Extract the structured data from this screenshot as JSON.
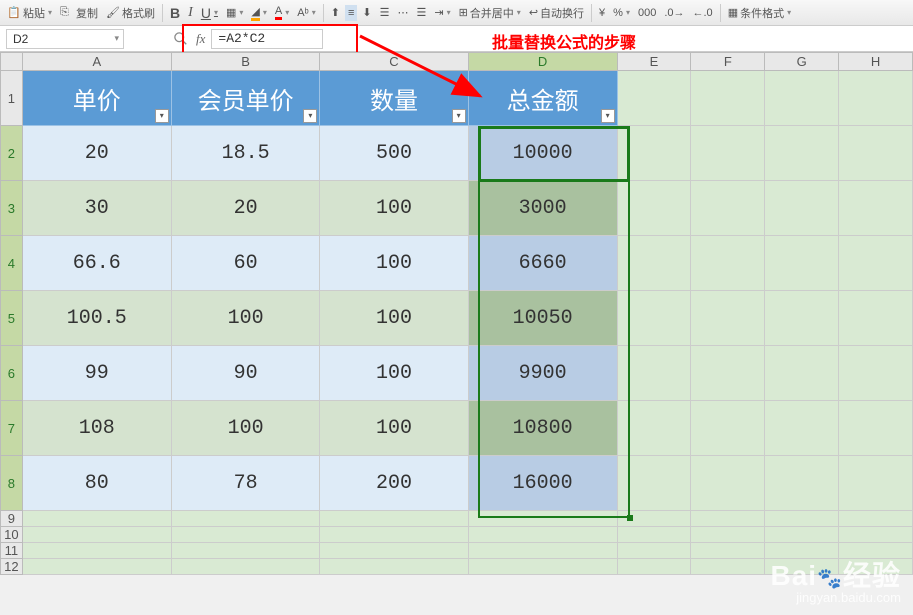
{
  "toolbar": {
    "paste": "粘贴",
    "copy": "复制",
    "format_painter": "格式刷",
    "bold": "B",
    "italic": "I",
    "underline": "U",
    "merge_center": "合并居中",
    "wrap_text": "自动换行",
    "conditional_format": "条件格式"
  },
  "formula_bar": {
    "name_box": "D2",
    "fx": "fx",
    "formula": "=A2*C2"
  },
  "annotation": "批量替换公式的步骤",
  "columns": [
    "A",
    "B",
    "C",
    "D",
    "E",
    "F",
    "G",
    "H"
  ],
  "rows": [
    "1",
    "2",
    "3",
    "4",
    "5",
    "6",
    "7",
    "8",
    "9",
    "10",
    "11",
    "12"
  ],
  "headers": {
    "A": "单价",
    "B": "会员单价",
    "C": "数量",
    "D": "总金额"
  },
  "chart_data": {
    "type": "table",
    "title": "",
    "columns": [
      "单价",
      "会员单价",
      "数量",
      "总金额"
    ],
    "rows": [
      {
        "单价": 20,
        "会员单价": 18.5,
        "数量": 500,
        "总金额": 10000
      },
      {
        "单价": 30,
        "会员单价": 20,
        "数量": 100,
        "总金额": 3000
      },
      {
        "单价": 66.6,
        "会员单价": 60,
        "数量": 100,
        "总金额": 6660
      },
      {
        "单价": 100.5,
        "会员单价": 100,
        "数量": 100,
        "总金额": 10050
      },
      {
        "单价": 99,
        "会员单价": 90,
        "数量": 100,
        "总金额": 9900
      },
      {
        "单价": 108,
        "会员单价": 100,
        "数量": 100,
        "总金额": 10800
      },
      {
        "单价": 80,
        "会员单价": 78,
        "数量": 200,
        "总金额": 16000
      }
    ],
    "formula_note": "总金额 = 单价 * 数量 (=A2*C2)"
  },
  "watermark": {
    "main": "Baidu 经验",
    "sub": "jingyan.baidu.com"
  }
}
